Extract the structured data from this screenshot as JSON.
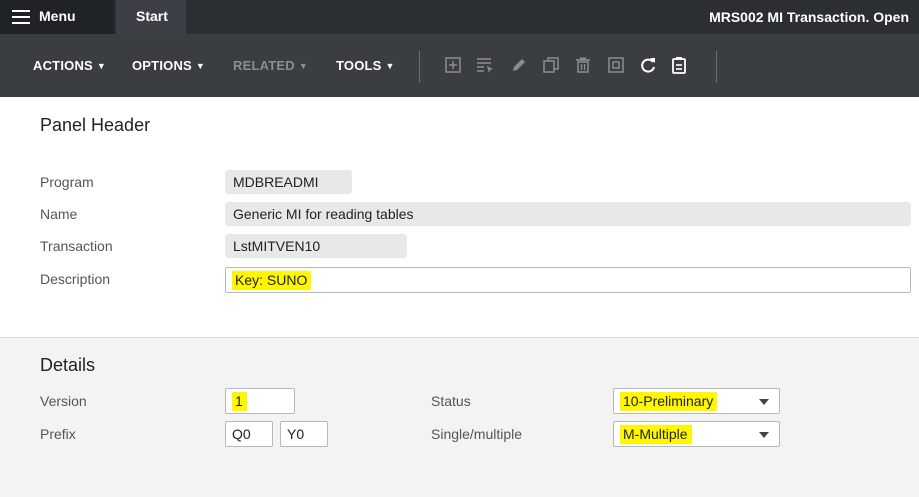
{
  "topbar": {
    "menu_label": "Menu",
    "start_label": "Start",
    "title": "MRS002 MI Transaction. Open"
  },
  "toolbar": {
    "actions_label": "ACTIONS",
    "options_label": "OPTIONS",
    "related_label": "RELATED",
    "tools_label": "TOOLS",
    "icons": [
      "add-icon",
      "filter-icon",
      "edit-icon",
      "copy-icon",
      "delete-icon",
      "copy-page-icon",
      "refresh-icon",
      "clipboard-icon"
    ]
  },
  "panel_header": {
    "title": "Panel Header",
    "program_label": "Program",
    "program_value": "MDBREADMI",
    "name_label": "Name",
    "name_value": "Generic MI for reading tables",
    "transaction_label": "Transaction",
    "transaction_value": "LstMITVEN10",
    "description_label": "Description",
    "description_value": "Key: SUNO"
  },
  "details": {
    "title": "Details",
    "version_label": "Version",
    "version_value": "1",
    "prefix_label": "Prefix",
    "prefix_value_1": "Q0",
    "prefix_value_2": "Y0",
    "status_label": "Status",
    "status_value": "10-Preliminary",
    "single_multiple_label": "Single/multiple",
    "single_multiple_value": "M-Multiple"
  },
  "colors": {
    "topbar_bg": "#2b2e33",
    "toolbar_bg": "#3a3d42",
    "highlight": "#fff700"
  }
}
